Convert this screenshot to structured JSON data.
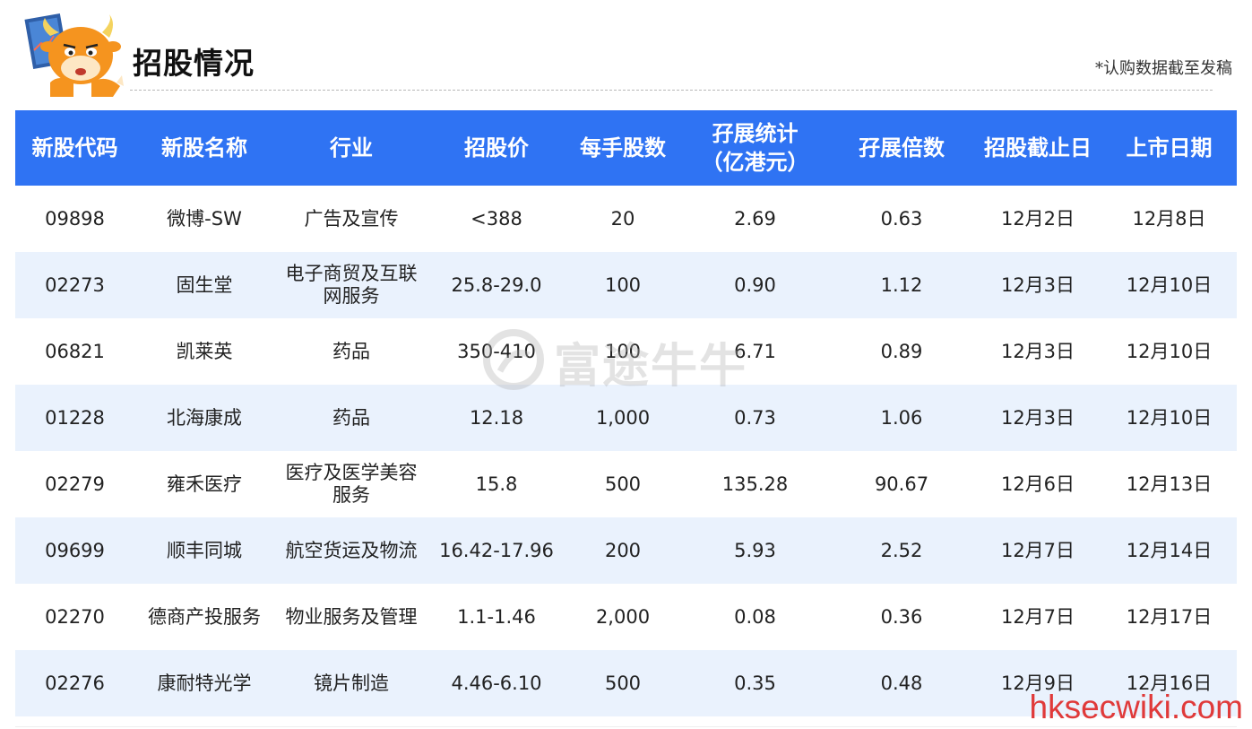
{
  "header": {
    "title": "招股情况",
    "note": "*认购数据截至发稿"
  },
  "table": {
    "columns": [
      "新股代码",
      "新股名称",
      "行业",
      "招股价",
      "每手股数",
      "孖展统计",
      "孖展倍数",
      "招股截止日",
      "上市日期"
    ],
    "column_sub": {
      "margin_unit": "（亿港元）"
    },
    "rows": [
      [
        "09898",
        "微博-SW",
        "广告及宣传",
        "<388",
        "20",
        "2.69",
        "0.63",
        "12月2日",
        "12月8日"
      ],
      [
        "02273",
        "固生堂",
        "电子商贸及互联网服务",
        "25.8-29.0",
        "100",
        "0.90",
        "1.12",
        "12月3日",
        "12月10日"
      ],
      [
        "06821",
        "凯莱英",
        "药品",
        "350-410",
        "100",
        "6.71",
        "0.89",
        "12月3日",
        "12月10日"
      ],
      [
        "01228",
        "北海康成",
        "药品",
        "12.18",
        "1,000",
        "0.73",
        "1.06",
        "12月3日",
        "12月10日"
      ],
      [
        "02279",
        "雍禾医疗",
        "医疗及医学美容服务",
        "15.8",
        "500",
        "135.28",
        "90.67",
        "12月6日",
        "12月13日"
      ],
      [
        "09699",
        "顺丰同城",
        "航空货运及物流",
        "16.42-17.96",
        "200",
        "5.93",
        "2.52",
        "12月7日",
        "12月14日"
      ],
      [
        "02270",
        "德商产投服务",
        "物业服务及管理",
        "1.1-1.46",
        "2,000",
        "0.08",
        "0.36",
        "12月7日",
        "12月17日"
      ],
      [
        "02276",
        "康耐特光学",
        "镜片制造",
        "4.46-6.10",
        "500",
        "0.35",
        "0.48",
        "12月9日",
        "12月16日"
      ]
    ]
  },
  "watermark": {
    "text": "富途牛牛",
    "icon": "futu-logo-icon"
  },
  "site_watermark": "hksecwiki.com",
  "colors": {
    "header_bg": "#2f73f3",
    "stripe_bg": "#eaf2fd",
    "site_watermark": "#e03a3a"
  }
}
